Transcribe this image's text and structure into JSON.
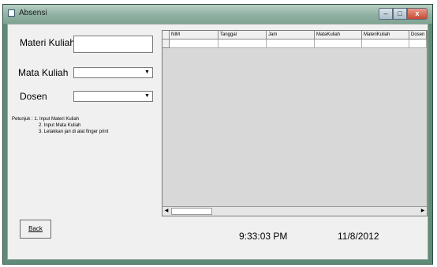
{
  "window": {
    "title": "Absensi",
    "controls": {
      "minimize": "–",
      "maximize": "□",
      "close": "x"
    }
  },
  "form": {
    "materi_label": "Materi Kuliah",
    "materi_value": "",
    "matakuliah_label": "Mata Kuliah",
    "matakuliah_value": "",
    "dosen_label": "Dosen",
    "dosen_value": ""
  },
  "instructions": {
    "line1": "Petunjuk : 1. Input Materi Kuliah",
    "line2": "2. Input Mata Kuliah",
    "line3": "3. Letakkan jari di alat finger print"
  },
  "grid": {
    "columns": [
      "NIM",
      "Tanggal",
      "Jam",
      "MataKuliah",
      "MateriKuliah",
      "Dosen"
    ],
    "rows": [
      [
        "",
        "",
        "",
        "",
        "",
        ""
      ]
    ]
  },
  "footer": {
    "back_label": "Back",
    "time": "9:33:03 PM",
    "date": "11/8/2012"
  },
  "colors": {
    "frame": "#5f8b78",
    "client": "#f0f0f0",
    "grid_bg": "#d8d8d8"
  }
}
